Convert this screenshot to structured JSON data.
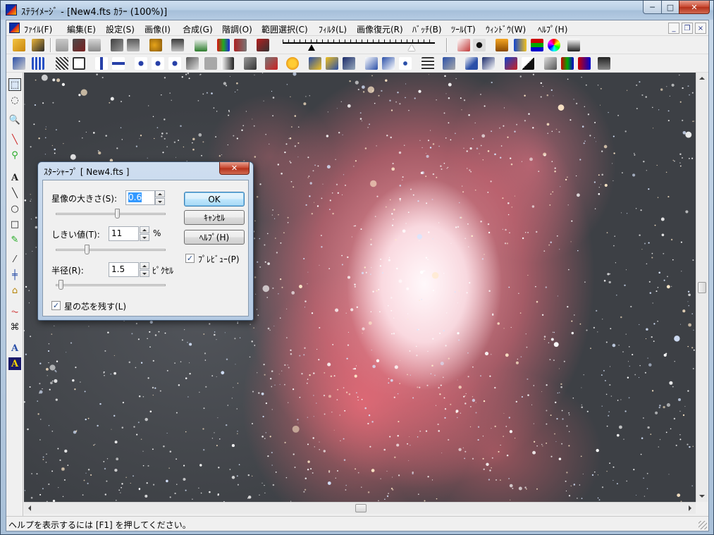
{
  "window": {
    "title": "ｽﾃﾗｲﾒｰｼﾞ - [New4.fts ｶﾗｰ (100%)]",
    "min_glyph": "─",
    "max_glyph": "□",
    "close_glyph": "✕"
  },
  "menu": {
    "items": [
      "ﾌｧｲﾙ(F)",
      "編集(E)",
      "設定(S)",
      "画像(I)",
      "合成(G)",
      "階調(O)",
      "範囲選択(C)",
      "ﾌｨﾙﾀ(L)",
      "画像復元(R)",
      "ﾊﾞｯﾁ(B)",
      "ﾂｰﾙ(T)",
      "ｳｨﾝﾄﾞｳ(W)",
      "ﾍﾙﾌﾟ(H)"
    ],
    "mdi_min": "_",
    "mdi_restore": "❐",
    "mdi_close": "×"
  },
  "palette": {
    "tools": [
      "⬚",
      "◌",
      "🔍",
      "╲",
      "⚲",
      "A",
      "╲",
      "○",
      "□",
      "✎",
      "⁄",
      "╪",
      "⌂",
      "⏦",
      "⌘",
      "A",
      "A"
    ]
  },
  "dialog": {
    "title": "ｽﾀｰｼｬｰﾌﾟ [ New4.fts ]",
    "close_glyph": "✕",
    "star_size_label": "星像の大きさ(S):",
    "star_size_value": "0.6",
    "threshold_label": "しきい値(T):",
    "threshold_value": "11",
    "threshold_unit": "%",
    "radius_label": "半径(R):",
    "radius_value": "1.5",
    "radius_unit": "ﾋﾟｸｾﾙ",
    "keep_core_label": "星の芯を残す(L)",
    "keep_core_checked": true,
    "preview_label": "ﾌﾟﾚﾋﾞｭｰ(P)",
    "preview_checked": true,
    "ok_label": "OK",
    "cancel_label": "ｷｬﾝｾﾙ",
    "help_label": "ﾍﾙﾌﾟ(H)",
    "check_glyph": "✓"
  },
  "status": {
    "text": "ヘルプを表示するには [F1] を押してください。"
  }
}
